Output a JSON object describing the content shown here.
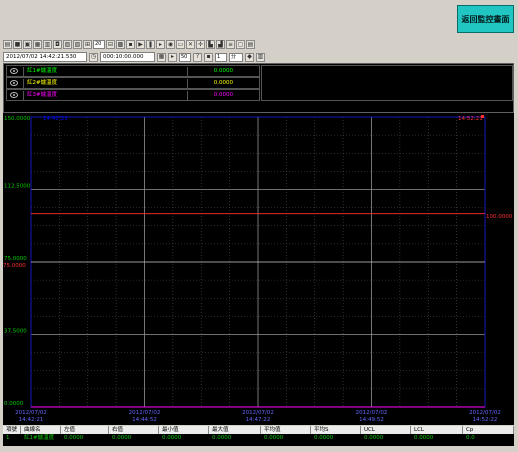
{
  "header": {
    "return_button": "返回監控畫面"
  },
  "toolbar": {
    "zoom_value": "20",
    "speed_value": "50",
    "step_value": "1",
    "unit_value": "分"
  },
  "time": {
    "start": "2012/07/02 14:42:21.530",
    "span": "000:10:00.000"
  },
  "legend": {
    "rows": [
      {
        "name": "紅1#爐溫度",
        "value": "0.0000",
        "color": "#00ff00"
      },
      {
        "name": "紅2#爐溫度",
        "value": "0.0000",
        "color": "#ffff00"
      },
      {
        "name": "紅3#爐溫度",
        "value": "0.0000",
        "color": "#ff00ff"
      }
    ]
  },
  "chart": {
    "y_ticks": [
      "150.0000",
      "112.5000",
      "75.0000",
      "37.5000",
      "0.0000"
    ],
    "top_left_time": "14:42:21",
    "top_right_time": "14:52:21",
    "red_line_label": "100.0000",
    "gray_line_label": "75.0000",
    "red_left_label": "75.0000",
    "x_labels": [
      {
        "date": "2012/07/02",
        "time": "14:42:21"
      },
      {
        "date": "2012/07/02",
        "time": "14:44:52"
      },
      {
        "date": "2012/07/02",
        "time": "14:47:22"
      },
      {
        "date": "2012/07/02",
        "time": "14:49:52"
      },
      {
        "date": "2012/07/02",
        "time": "14:52:22"
      }
    ]
  },
  "chart_data": {
    "type": "line",
    "ylim": [
      0,
      150
    ],
    "y_ticks": [
      0,
      37.5,
      75,
      112.5,
      150
    ],
    "x_tick_labels": [
      "14:42:21",
      "14:44:52",
      "14:47:22",
      "14:49:52",
      "14:52:22"
    ],
    "series": [
      {
        "name": "紅1#爐溫度",
        "color": "#00ff00",
        "values": [
          0,
          0
        ]
      },
      {
        "name": "紅2#爐溫度",
        "color": "#ffff00",
        "values": [
          0,
          0
        ]
      },
      {
        "name": "紅3#爐溫度",
        "color": "#ff00ff",
        "values": [
          0,
          0
        ]
      }
    ],
    "reference_lines": [
      {
        "value": 100,
        "color": "#ff3333"
      },
      {
        "value": 75,
        "color": "#aaaaaa"
      }
    ]
  },
  "table": {
    "headers": [
      "項號",
      "曲線名",
      "左值",
      "右值",
      "最小值",
      "最大值",
      "平均值",
      "平均S",
      "UCL",
      "LCL",
      "Cp"
    ],
    "row": [
      "1",
      "紅1#爐溫度",
      "0.0000",
      "0.0000",
      "0.0000",
      "0.0000",
      "0.0000",
      "0.0000",
      "0.0000",
      "0.0000",
      "0.0"
    ]
  }
}
